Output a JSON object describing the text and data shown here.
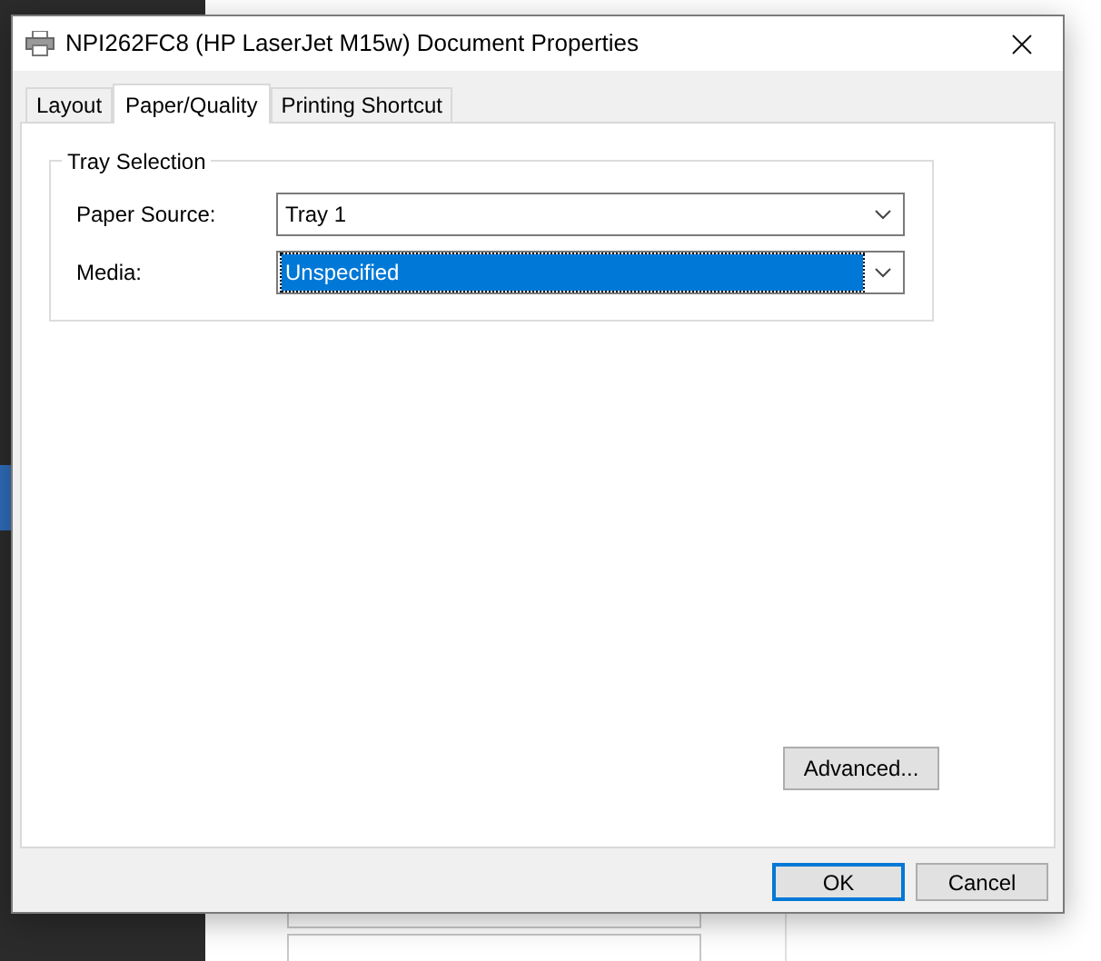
{
  "window": {
    "title": "NPI262FC8 (HP LaserJet M15w) Document Properties"
  },
  "tabs": [
    {
      "label": "Layout",
      "selected": false
    },
    {
      "label": "Paper/Quality",
      "selected": true
    },
    {
      "label": "Printing Shortcut",
      "selected": false
    }
  ],
  "tray_selection": {
    "title": "Tray Selection",
    "fields": [
      {
        "label": "Paper Source:",
        "value": "Tray 1",
        "focused": false
      },
      {
        "label": "Media:",
        "value": "Unspecified",
        "focused": true
      }
    ]
  },
  "advanced_button": "Advanced...",
  "buttons": [
    {
      "label": "OK",
      "default": true
    },
    {
      "label": "Cancel",
      "default": false
    }
  ]
}
